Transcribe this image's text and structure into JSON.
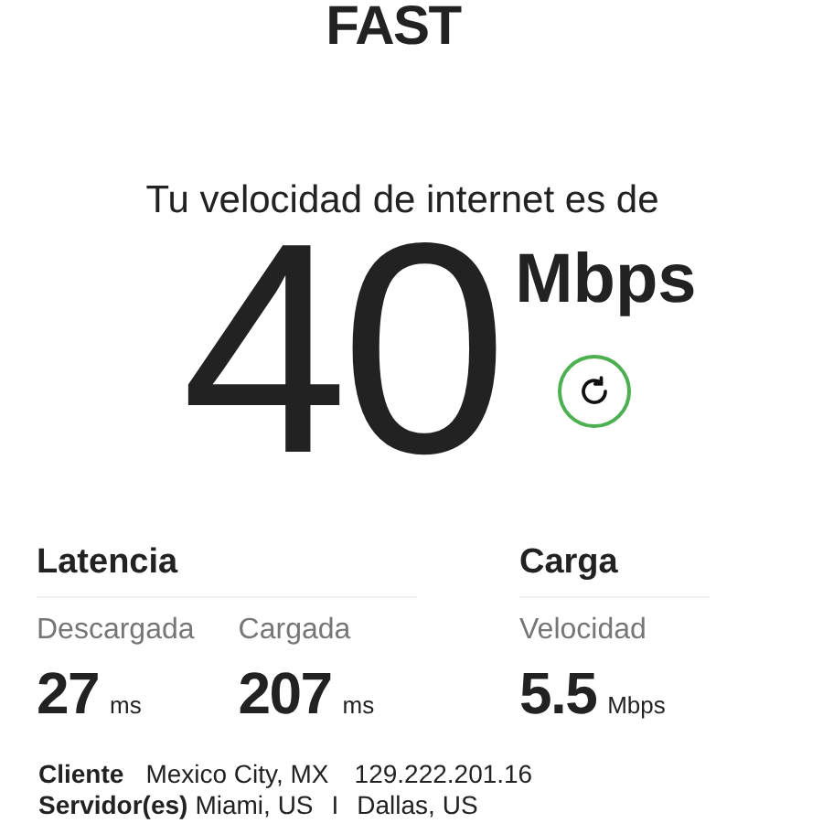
{
  "logo": "FAST",
  "heading": "Tu velocidad de internet es de",
  "speed": {
    "value": "40",
    "unit": "Mbps"
  },
  "latency": {
    "title": "Latencia",
    "items": [
      {
        "label": "Descargada",
        "value": "27",
        "unit": "ms"
      },
      {
        "label": "Cargada",
        "value": "207",
        "unit": "ms"
      }
    ]
  },
  "upload": {
    "title": "Carga",
    "items": [
      {
        "label": "Velocidad",
        "value": "5.5",
        "unit": "Mbps"
      }
    ]
  },
  "client": {
    "label": "Cliente",
    "location": "Mexico City, MX",
    "ip": "129.222.201.16"
  },
  "servers": {
    "label": "Servidor(es)",
    "items": [
      "Miami, US",
      "Dallas, US"
    ],
    "separator": "I"
  }
}
